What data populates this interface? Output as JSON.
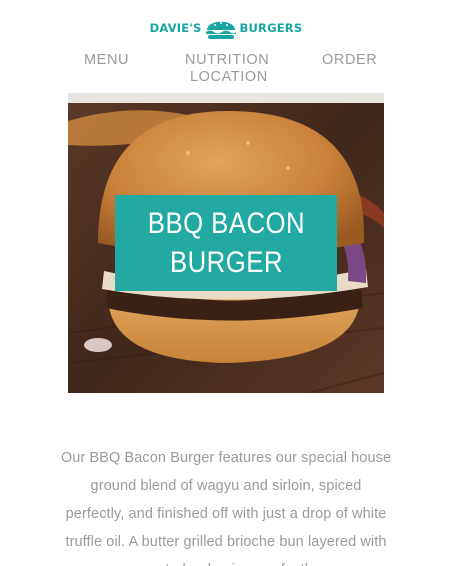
{
  "brand": {
    "name_left": "DAVIE'S",
    "name_right": "BURGERS",
    "color": "#1aa5a5"
  },
  "nav": {
    "menu": "MENU",
    "nutrition": "NUTRITION",
    "order": "ORDER",
    "location": "LOCATION"
  },
  "hero": {
    "title": "BBQ BACON\nBURGER",
    "overlay_color": "#22a9a2"
  },
  "description": {
    "text": "Our BBQ Bacon Burger features our special house ground blend of wagyu and sirloin, spiced perfectly, and finished off with just a drop of white truffle oil. A butter grilled brioche bun layered with roasted red onion, perfectly"
  },
  "colors": {
    "nav_text": "#9a9a9a",
    "body_text": "#9a9a9a"
  }
}
